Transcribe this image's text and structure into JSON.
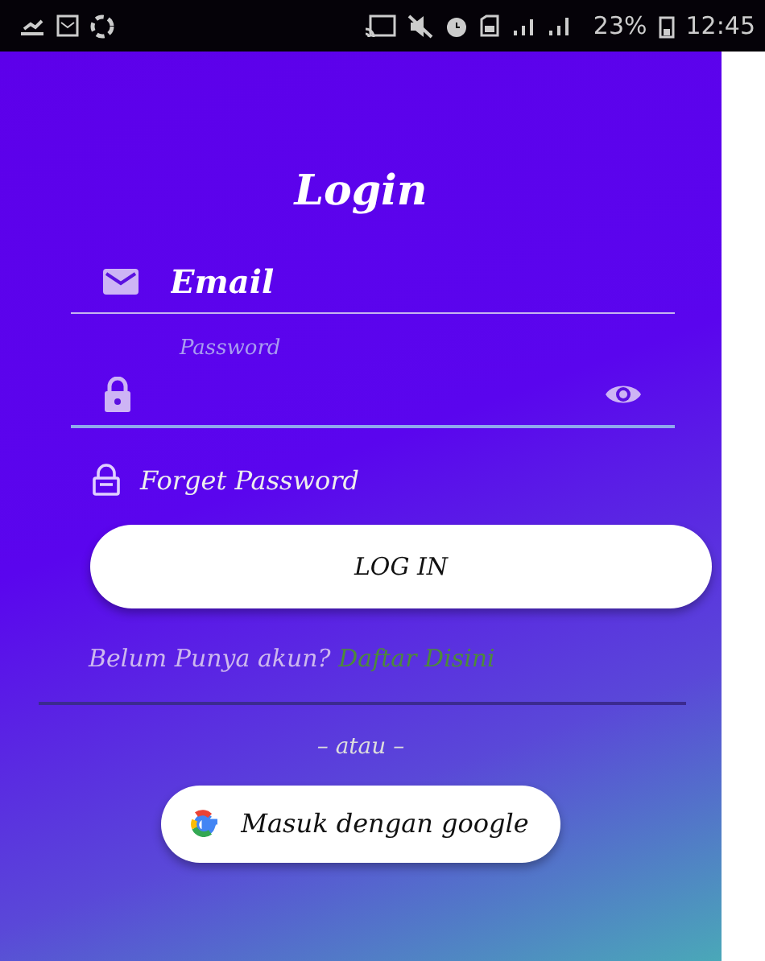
{
  "status_bar": {
    "battery": "23%",
    "time": "12:45"
  },
  "title": "Login",
  "email_field": {
    "placeholder": "Email"
  },
  "password_field": {
    "label": "Password"
  },
  "forget_password": "Forget Password",
  "login_button": "LOG IN",
  "signup_prompt": {
    "text": "Belum Punya akun?",
    "link": "Daftar Disini"
  },
  "separator": "– atau –",
  "google_button": "Masuk dengan google"
}
